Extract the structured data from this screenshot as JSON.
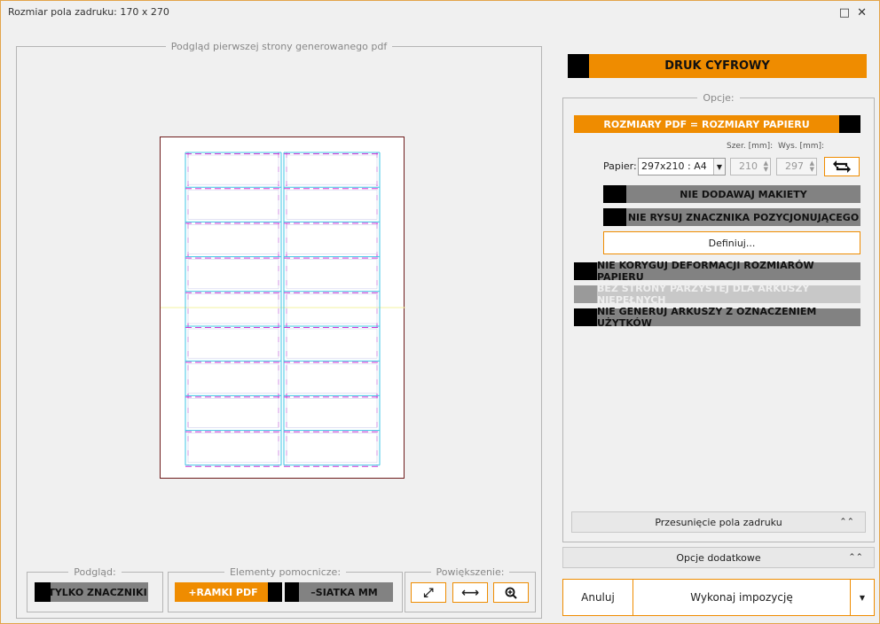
{
  "window": {
    "title": "Rozmiar pola zadruku: 170 x 270",
    "maximize_icon": "maximize-icon",
    "close_icon": "close-icon"
  },
  "preview": {
    "legend": "Podgląd pierwszej strony generowanego pdf"
  },
  "bottom": {
    "podglad_legend": "Podgląd:",
    "tylko_znaczniki": "TYLKO ZNACZNIKI",
    "elementy_legend": "Elementy pomocnicze:",
    "ramki_pdf": "+RAMKI PDF",
    "siatka_mm": "–SIATKA MM",
    "powiekszenie_legend": "Powiększenie:",
    "zoom_fit_icon": "expand-diagonal-icon",
    "zoom_width_icon": "fit-width-icon",
    "zoom_in_icon": "zoom-in-icon"
  },
  "right": {
    "druk_cyfrowy": "DRUK CYFROWY",
    "opcje_legend": "Opcje:",
    "rozmiary_pdf": "ROZMIARY PDF = ROZMIARY PAPIERU",
    "szer_label": "Szer. [mm]:",
    "wys_label": "Wys. [mm]:",
    "papier_label": "Papier:",
    "papier_value": "297x210 : A4",
    "szer_value": "210",
    "wys_value": "297",
    "rotate_icon": "swap-orientation-icon",
    "nie_dodawaj": "NIE DODAWAJ MAKIETY",
    "nie_rysuj": "NIE RYSUJ ZNACZNIKA POZYCJONUJĄCEGO",
    "definiuj": "Definiuj...",
    "nie_koryguj": "NIE KORYGUJ DEFORMACJI ROZMIARÓW PAPIERU",
    "bez_strony": "BEZ STRONY PARZYSTEJ DLA ARKUSZY NIEPEŁNYCH",
    "nie_generuj": "NIE GENERUJ ARKUSZY Z OZNACZENIEM UŻYTKÓW",
    "przesuniecie": "Przesunięcie pola zadruku",
    "opcje_dodatkowe": "Opcje dodatkowe",
    "anuluj": "Anuluj",
    "wykonaj": "Wykonaj impozycję"
  },
  "colors": {
    "accent": "#ef8c00",
    "dark_toggle": "#828282",
    "magenta_guide": "#d43ad6",
    "cyan_guide": "#3fc4e6"
  }
}
